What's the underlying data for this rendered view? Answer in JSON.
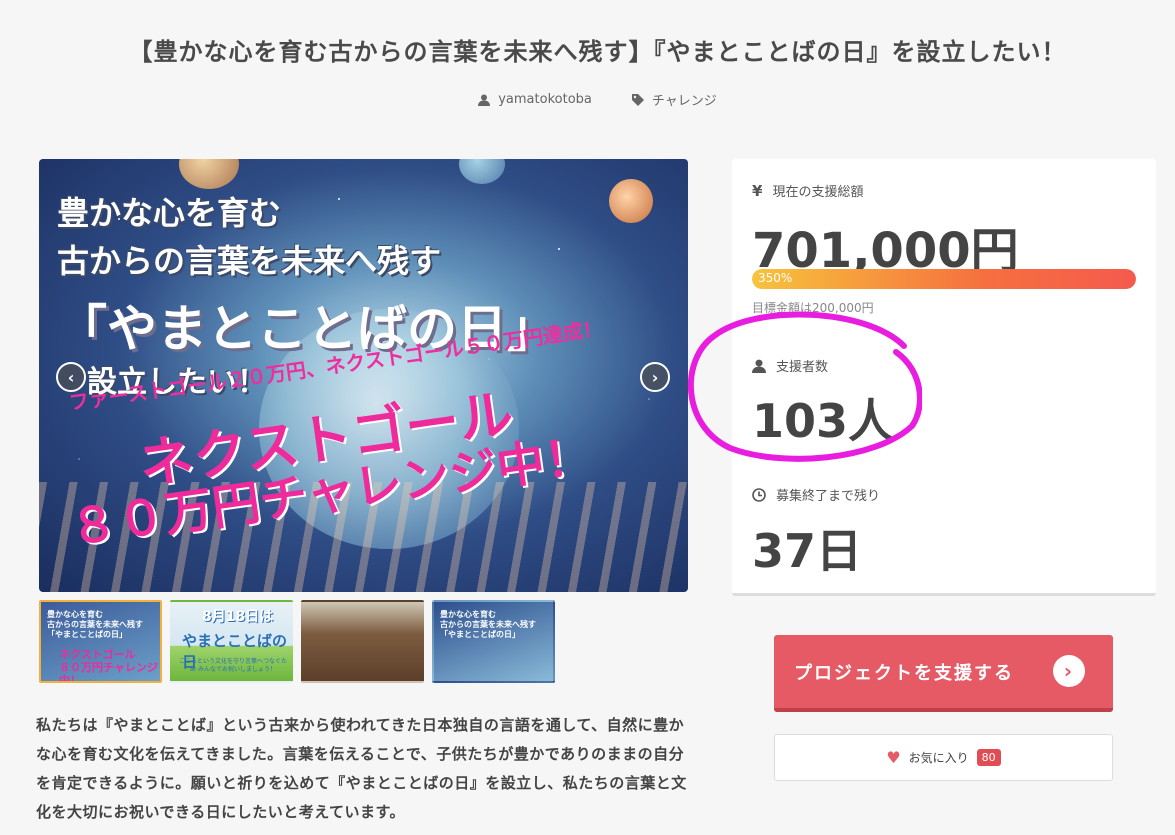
{
  "project": {
    "title": "【豊かな心を育む古からの言葉を未来へ残す】『やまとことばの日』を設立したい！",
    "author": "yamatokotoba",
    "category": "チャレンジ"
  },
  "hero": {
    "line1": "豊かな心を育む",
    "line2": "古からの言葉を未来へ残す",
    "line3": "「やまとことばの日」",
    "line4": "設立したい！",
    "pink1": "ファーストゴール２０万円、ネクストゴール５０万円達成！",
    "pink2": "ネクストゴール",
    "pink3": "８０万円チャレンジ中！",
    "prev_icon": "chevron-left-icon",
    "next_icon": "chevron-right-icon"
  },
  "thumbnails": [
    {
      "line1": "豊かな心を育む",
      "line2": "古からの言葉を未来へ残す",
      "line3": "「やまとことばの日」",
      "pink1": "ネクストゴール",
      "pink2": "８０万円チャレンジ中！"
    },
    {
      "line1": "8月18日は",
      "line2": "やまとことばの日",
      "line3": "こころという文化を守り言葉へつなぐため みんなでお祝いしましょう！"
    },
    {},
    {
      "line1": "豊かな心を育む",
      "line2": "古からの言葉を未来へ残す",
      "line3": "「やまとことばの日」"
    }
  ],
  "description": "私たちは『やまとことば』という古来から使われてきた日本独自の言語を通して、自然に豊かな心を育む文化を伝えてきました。言葉を伝えることで、子供たちが豊かでありのままの自分を肯定できるように。願いと祈りを込めて『やまとことばの日』を設立し、私たちの言葉と文化を大切にお祝いできる日にしたいと考えています。",
  "stats": {
    "amount_label": "現在の支援総額",
    "amount_value": "701,000円",
    "progress_percent": 350,
    "progress_text": "350%",
    "goal_text": "目標金額は200,000円",
    "supporters_label": "支援者数",
    "supporters_value": "103人",
    "remaining_label": "募集終了まで残り",
    "remaining_value": "37日"
  },
  "actions": {
    "support_label": "プロジェクトを支援する",
    "favorite_label": "お気に入り",
    "favorite_count": "80"
  },
  "colors": {
    "accent": "#e55a64",
    "highlight_circle": "#e81de0",
    "progress_start": "#f7c33c",
    "progress_end": "#f45a4e"
  }
}
